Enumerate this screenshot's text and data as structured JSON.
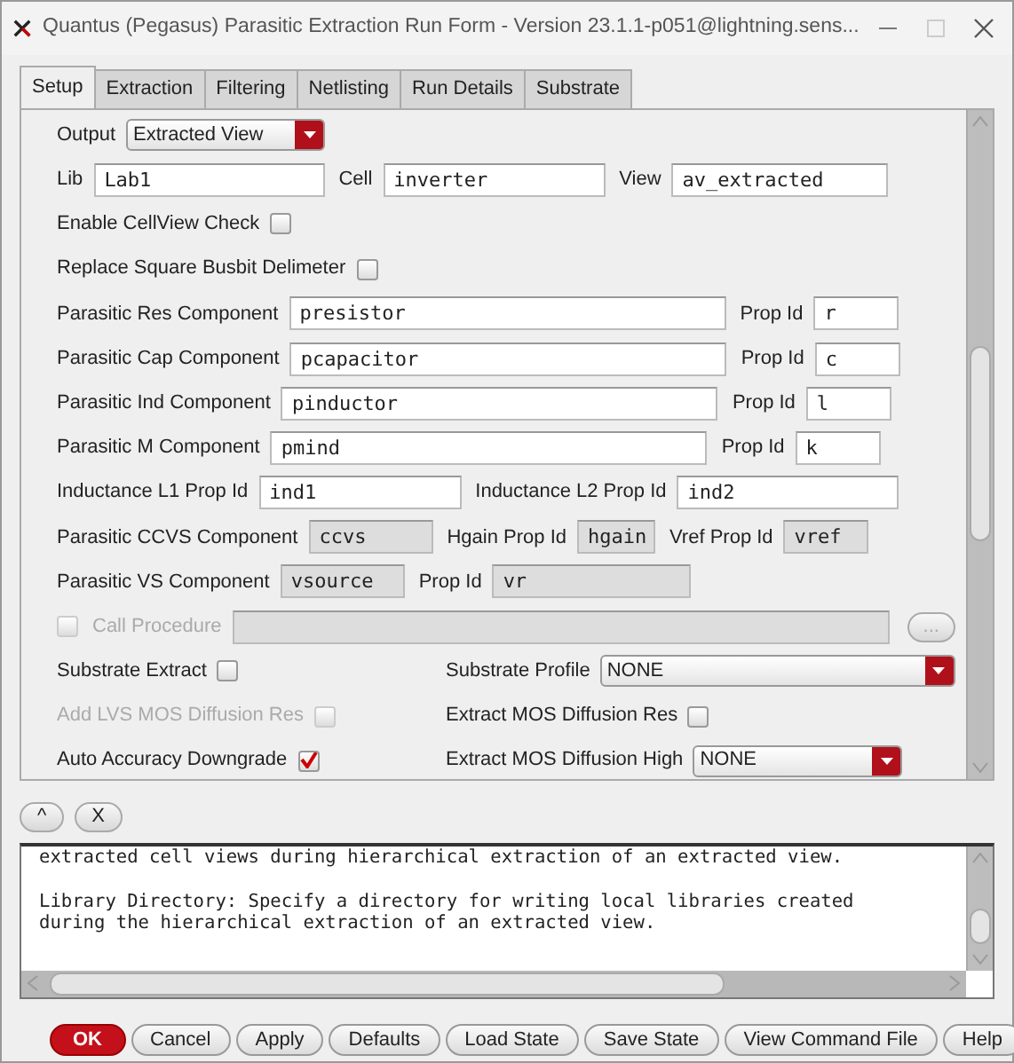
{
  "window": {
    "title": "Quantus (Pegasus) Parasitic Extraction Run Form - Version 23.1.1-p051@lightning.sens..."
  },
  "tabs": [
    {
      "label": "Setup",
      "selected": true
    },
    {
      "label": "Extraction",
      "selected": false
    },
    {
      "label": "Filtering",
      "selected": false
    },
    {
      "label": "Netlisting",
      "selected": false
    },
    {
      "label": "Run Details",
      "selected": false
    },
    {
      "label": "Substrate",
      "selected": false
    }
  ],
  "form": {
    "rows": [
      {
        "items": [
          {
            "kind": "label",
            "text": "Output"
          },
          {
            "kind": "dropdown",
            "value": "Extracted View"
          }
        ]
      },
      {
        "items": [
          {
            "kind": "label",
            "text": "Lib"
          },
          {
            "kind": "field",
            "value": "Lab1",
            "disabled": false
          },
          {
            "kind": "label",
            "text": "Cell"
          },
          {
            "kind": "field",
            "value": "inverter",
            "disabled": false
          },
          {
            "kind": "label",
            "text": "View"
          },
          {
            "kind": "field",
            "value": "av_extracted",
            "disabled": false
          }
        ]
      },
      {
        "items": [
          {
            "kind": "label",
            "text": "Enable CellView Check"
          },
          {
            "kind": "checkbox",
            "checked": false,
            "disabled": false
          }
        ]
      },
      {
        "items": [
          {
            "kind": "label",
            "text": "Replace Square Busbit Delimeter"
          },
          {
            "kind": "checkbox",
            "checked": false,
            "disabled": false
          }
        ]
      },
      {
        "items": [
          {
            "kind": "label",
            "text": "Parasitic Res Component"
          },
          {
            "kind": "field",
            "value": "presistor",
            "disabled": false
          },
          {
            "kind": "label",
            "text": "Prop Id"
          },
          {
            "kind": "field",
            "value": "r",
            "disabled": false
          }
        ]
      },
      {
        "items": [
          {
            "kind": "label",
            "text": "Parasitic Cap Component"
          },
          {
            "kind": "field",
            "value": "pcapacitor",
            "disabled": false
          },
          {
            "kind": "label",
            "text": "Prop Id"
          },
          {
            "kind": "field",
            "value": "c",
            "disabled": false
          }
        ]
      },
      {
        "items": [
          {
            "kind": "label",
            "text": "Parasitic Ind Component"
          },
          {
            "kind": "field",
            "value": "pinductor",
            "disabled": false
          },
          {
            "kind": "label",
            "text": "Prop Id"
          },
          {
            "kind": "field",
            "value": "l",
            "disabled": false
          }
        ]
      },
      {
        "items": [
          {
            "kind": "label",
            "text": "Parasitic M Component"
          },
          {
            "kind": "field",
            "value": "pmind",
            "disabled": false
          },
          {
            "kind": "label",
            "text": "Prop Id"
          },
          {
            "kind": "field",
            "value": "k",
            "disabled": false
          }
        ]
      },
      {
        "items": [
          {
            "kind": "label",
            "text": "Inductance L1 Prop Id"
          },
          {
            "kind": "field",
            "value": "ind1",
            "disabled": false
          },
          {
            "kind": "label",
            "text": "Inductance L2 Prop Id"
          },
          {
            "kind": "field",
            "value": "ind2",
            "disabled": false
          }
        ]
      },
      {
        "items": [
          {
            "kind": "label",
            "text": "Parasitic CCVS Component"
          },
          {
            "kind": "field",
            "value": "ccvs",
            "disabled": true
          },
          {
            "kind": "label",
            "text": "Hgain Prop Id"
          },
          {
            "kind": "field",
            "value": "hgain",
            "disabled": true
          },
          {
            "kind": "label",
            "text": "Vref Prop Id"
          },
          {
            "kind": "field",
            "value": "vref",
            "disabled": true
          }
        ]
      },
      {
        "items": [
          {
            "kind": "label",
            "text": "Parasitic VS Component"
          },
          {
            "kind": "field",
            "value": "vsource",
            "disabled": true
          },
          {
            "kind": "label",
            "text": "Prop Id"
          },
          {
            "kind": "field",
            "value": "vr",
            "disabled": true
          }
        ]
      },
      {
        "items": [
          {
            "kind": "checkbox",
            "checked": false,
            "disabled": true
          },
          {
            "kind": "label",
            "text": "Call Procedure",
            "disabled": true
          },
          {
            "kind": "field",
            "disabled": true
          },
          {
            "kind": "button",
            "text": "...",
            "disabled": true
          }
        ]
      },
      {
        "columns": [
          [
            {
              "kind": "label",
              "text": "Substrate Extract"
            },
            {
              "kind": "checkbox",
              "checked": false,
              "disabled": false
            }
          ],
          [
            {
              "kind": "label",
              "text": "Substrate Profile"
            },
            {
              "kind": "dropdown",
              "value": "NONE"
            }
          ]
        ]
      },
      {
        "columns": [
          [
            {
              "kind": "label",
              "text": "Add LVS MOS Diffusion Res",
              "disabled": true
            },
            {
              "kind": "checkbox",
              "checked": false,
              "disabled": true
            }
          ],
          [
            {
              "kind": "label",
              "text": "Extract MOS Diffusion Res"
            },
            {
              "kind": "checkbox",
              "checked": false,
              "disabled": false
            }
          ]
        ]
      },
      {
        "columns": [
          [
            {
              "kind": "label",
              "text": "Auto Accuracy Downgrade"
            },
            {
              "kind": "checkbox",
              "checked": true,
              "disabled": false
            }
          ],
          [
            {
              "kind": "label",
              "text": "Extract MOS Diffusion High"
            },
            {
              "kind": "dropdown",
              "value": "NONE"
            }
          ]
        ]
      }
    ]
  },
  "help_toggles": [
    "^",
    "X"
  ],
  "help_paragraphs": [
    {
      "lines": [
        "extracted cell views during hierarchical extraction of an extracted view."
      ]
    },
    {
      "lines": [
        "Library Directory: Specify a directory for writing local libraries created",
        "during the hierarchical extraction of an extracted view."
      ]
    }
  ],
  "buttons": [
    {
      "label": "OK",
      "kind": "primary"
    },
    {
      "label": "Cancel",
      "kind": "plain"
    },
    {
      "label": "Apply",
      "kind": "plain"
    },
    {
      "label": "Defaults",
      "kind": "plain"
    },
    {
      "label": "Load State",
      "kind": "plain"
    },
    {
      "label": "Save State",
      "kind": "plain"
    },
    {
      "label": "View Command File",
      "kind": "plain"
    },
    {
      "label": "Help",
      "kind": "plain"
    }
  ]
}
